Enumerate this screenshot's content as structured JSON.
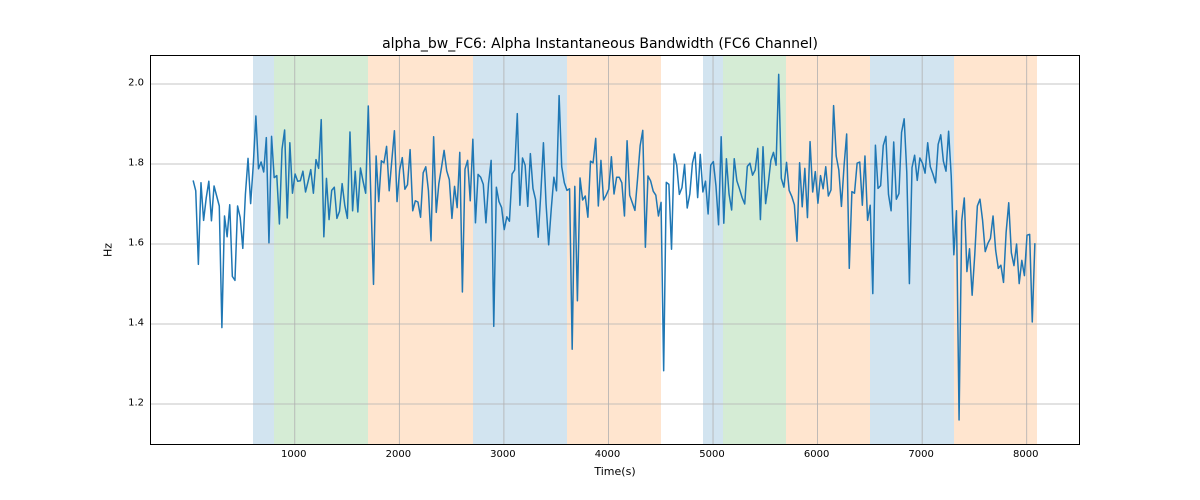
{
  "chart_data": {
    "type": "line",
    "title": "alpha_bw_FC6: Alpha Instantaneous Bandwidth (FC6 Channel)",
    "xlabel": "Time(s)",
    "ylabel": "Hz",
    "xlim": [
      -375,
      8500
    ],
    "ylim": [
      1.1,
      2.07
    ],
    "xticks": [
      1000,
      2000,
      3000,
      4000,
      5000,
      6000,
      7000,
      8000
    ],
    "yticks": [
      1.2,
      1.4,
      1.6,
      1.8,
      2.0
    ],
    "bands": [
      {
        "color": "blue",
        "x0": 600,
        "x1": 800
      },
      {
        "color": "green",
        "x0": 800,
        "x1": 1700
      },
      {
        "color": "orange",
        "x0": 1700,
        "x1": 2700
      },
      {
        "color": "blue",
        "x0": 2700,
        "x1": 3600
      },
      {
        "color": "orange",
        "x0": 3600,
        "x1": 4500
      },
      {
        "color": "blue",
        "x0": 4900,
        "x1": 5100
      },
      {
        "color": "green",
        "x0": 5100,
        "x1": 5700
      },
      {
        "color": "orange",
        "x0": 5700,
        "x1": 6500
      },
      {
        "color": "blue",
        "x0": 6500,
        "x1": 7300
      },
      {
        "color": "orange",
        "x0": 7300,
        "x1": 8100
      }
    ],
    "x": [
      28,
      53,
      78,
      103,
      128,
      153,
      178,
      203,
      228,
      253,
      278,
      303,
      328,
      353,
      378,
      403,
      428,
      453,
      478,
      503,
      528,
      553,
      578,
      603,
      628,
      653,
      678,
      703,
      728,
      753,
      778,
      803,
      828,
      853,
      878,
      903,
      928,
      953,
      978,
      1003,
      1028,
      1053,
      1078,
      1103,
      1128,
      1153,
      1178,
      1203,
      1228,
      1253,
      1278,
      1303,
      1328,
      1353,
      1378,
      1403,
      1428,
      1453,
      1478,
      1503,
      1528,
      1553,
      1578,
      1603,
      1628,
      1653,
      1678,
      1703,
      1728,
      1753,
      1778,
      1803,
      1828,
      1853,
      1878,
      1903,
      1928,
      1953,
      1978,
      2003,
      2028,
      2053,
      2078,
      2103,
      2128,
      2153,
      2178,
      2203,
      2228,
      2253,
      2278,
      2303,
      2328,
      2353,
      2378,
      2403,
      2428,
      2453,
      2478,
      2503,
      2528,
      2553,
      2578,
      2603,
      2628,
      2653,
      2678,
      2703,
      2728,
      2753,
      2778,
      2803,
      2828,
      2853,
      2878,
      2903,
      2928,
      2953,
      2978,
      3003,
      3028,
      3053,
      3078,
      3103,
      3128,
      3153,
      3178,
      3203,
      3228,
      3253,
      3278,
      3303,
      3328,
      3353,
      3378,
      3403,
      3428,
      3453,
      3478,
      3503,
      3528,
      3553,
      3578,
      3603,
      3628,
      3653,
      3678,
      3703,
      3728,
      3753,
      3778,
      3803,
      3828,
      3853,
      3878,
      3903,
      3928,
      3953,
      3978,
      4003,
      4028,
      4053,
      4078,
      4103,
      4128,
      4153,
      4178,
      4203,
      4228,
      4253,
      4278,
      4303,
      4328,
      4353,
      4378,
      4403,
      4428,
      4453,
      4478,
      4503,
      4528,
      4553,
      4578,
      4603,
      4628,
      4653,
      4678,
      4703,
      4728,
      4753,
      4778,
      4803,
      4828,
      4853,
      4878,
      4903,
      4928,
      4953,
      4978,
      5003,
      5028,
      5053,
      5078,
      5103,
      5128,
      5153,
      5178,
      5203,
      5228,
      5253,
      5278,
      5303,
      5328,
      5353,
      5378,
      5403,
      5428,
      5453,
      5478,
      5503,
      5528,
      5553,
      5578,
      5603,
      5628,
      5653,
      5678,
      5703,
      5728,
      5753,
      5778,
      5803,
      5828,
      5853,
      5878,
      5903,
      5928,
      5953,
      5978,
      6003,
      6028,
      6053,
      6078,
      6103,
      6128,
      6153,
      6178,
      6203,
      6228,
      6253,
      6278,
      6303,
      6328,
      6353,
      6378,
      6403,
      6428,
      6453,
      6478,
      6503,
      6528,
      6553,
      6578,
      6603,
      6628,
      6653,
      6678,
      6703,
      6728,
      6753,
      6778,
      6803,
      6828,
      6853,
      6878,
      6903,
      6928,
      6953,
      6978,
      7003,
      7028,
      7053,
      7078,
      7103,
      7128,
      7153,
      7178,
      7203,
      7228,
      7253,
      7278,
      7303,
      7328,
      7353,
      7378,
      7403,
      7428,
      7453,
      7478,
      7503,
      7528,
      7553,
      7578,
      7603,
      7628,
      7653,
      7678,
      7703,
      7728,
      7753,
      7778,
      7803,
      7828,
      7853,
      7878,
      7903,
      7928,
      7953,
      7978,
      8003,
      8028,
      8053,
      8078,
      8103
    ],
    "values": [
      1.759,
      1.733,
      1.549,
      1.753,
      1.659,
      1.715,
      1.757,
      1.658,
      1.745,
      1.72,
      1.695,
      1.391,
      1.67,
      1.618,
      1.698,
      1.519,
      1.509,
      1.695,
      1.666,
      1.589,
      1.725,
      1.814,
      1.701,
      1.797,
      1.92,
      1.788,
      1.805,
      1.78,
      1.866,
      1.603,
      1.869,
      1.766,
      1.771,
      1.65,
      1.837,
      1.885,
      1.665,
      1.853,
      1.727,
      1.775,
      1.757,
      1.758,
      1.782,
      1.73,
      1.757,
      1.786,
      1.727,
      1.811,
      1.789,
      1.911,
      1.618,
      1.764,
      1.661,
      1.734,
      1.742,
      1.664,
      1.682,
      1.751,
      1.697,
      1.664,
      1.88,
      1.683,
      1.782,
      1.68,
      1.79,
      1.757,
      1.727,
      1.945,
      1.712,
      1.499,
      1.82,
      1.706,
      1.808,
      1.803,
      1.844,
      1.733,
      1.809,
      1.883,
      1.706,
      1.785,
      1.816,
      1.737,
      1.748,
      1.836,
      1.683,
      1.708,
      1.705,
      1.667,
      1.778,
      1.793,
      1.734,
      1.608,
      1.868,
      1.679,
      1.751,
      1.791,
      1.834,
      1.783,
      1.761,
      1.664,
      1.744,
      1.691,
      1.829,
      1.48,
      1.787,
      1.809,
      1.708,
      1.862,
      1.653,
      1.774,
      1.767,
      1.749,
      1.653,
      1.751,
      1.809,
      1.394,
      1.742,
      1.706,
      1.691,
      1.636,
      1.668,
      1.657,
      1.775,
      1.785,
      1.926,
      1.697,
      1.815,
      1.797,
      1.694,
      1.826,
      1.739,
      1.711,
      1.617,
      1.726,
      1.853,
      1.701,
      1.598,
      1.688,
      1.767,
      1.733,
      1.971,
      1.793,
      1.753,
      1.734,
      1.738,
      1.337,
      1.744,
      1.458,
      1.765,
      1.71,
      1.72,
      1.667,
      1.807,
      1.803,
      1.864,
      1.695,
      1.809,
      1.71,
      1.722,
      1.737,
      1.818,
      1.725,
      1.767,
      1.767,
      1.753,
      1.67,
      1.858,
      1.722,
      1.703,
      1.684,
      1.762,
      1.846,
      1.884,
      1.592,
      1.77,
      1.758,
      1.732,
      1.722,
      1.67,
      1.704,
      1.283,
      1.754,
      1.749,
      1.587,
      1.825,
      1.797,
      1.724,
      1.741,
      1.799,
      1.69,
      1.725,
      1.802,
      1.829,
      1.716,
      1.824,
      1.73,
      1.757,
      1.675,
      1.797,
      1.806,
      1.745,
      1.648,
      1.868,
      1.652,
      1.813,
      1.725,
      1.685,
      1.813,
      1.758,
      1.738,
      1.716,
      1.7,
      1.794,
      1.802,
      1.772,
      1.785,
      1.839,
      1.661,
      1.843,
      1.701,
      1.75,
      1.809,
      1.829,
      1.797,
      2.024,
      1.764,
      1.742,
      1.804,
      1.734,
      1.719,
      1.698,
      1.607,
      1.803,
      1.693,
      1.789,
      1.666,
      1.856,
      1.73,
      1.781,
      1.702,
      1.771,
      1.738,
      1.793,
      1.72,
      1.735,
      1.946,
      1.82,
      1.785,
      1.694,
      1.795,
      1.875,
      1.539,
      1.731,
      1.727,
      1.802,
      1.805,
      1.697,
      1.82,
      1.659,
      1.697,
      1.476,
      1.847,
      1.739,
      1.746,
      1.846,
      1.869,
      1.724,
      1.683,
      1.855,
      1.712,
      1.726,
      1.879,
      1.913,
      1.779,
      1.501,
      1.791,
      1.822,
      1.759,
      1.815,
      1.802,
      1.777,
      1.853,
      1.793,
      1.775,
      1.753,
      1.849,
      1.873,
      1.807,
      1.782,
      1.882,
      1.77,
      1.573,
      1.683,
      1.16,
      1.657,
      1.715,
      1.531,
      1.588,
      1.472,
      1.573,
      1.695,
      1.712,
      1.659,
      1.581,
      1.601,
      1.614,
      1.67,
      1.584,
      1.539,
      1.547,
      1.504,
      1.629,
      1.703,
      1.578,
      1.546,
      1.6,
      1.501,
      1.559,
      1.521,
      1.622,
      1.624,
      1.405,
      1.602
    ]
  }
}
